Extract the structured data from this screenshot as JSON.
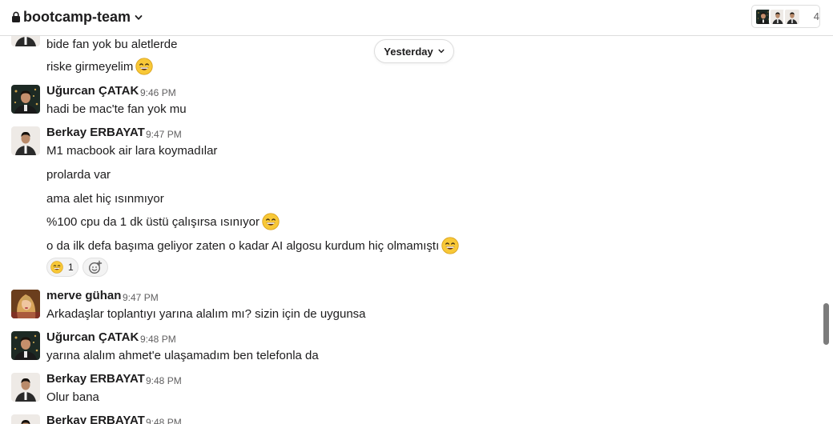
{
  "channel": {
    "name": "bootcamp-team",
    "icon": "lock-icon",
    "chevron": "chevron-down-icon"
  },
  "members": {
    "count": "4"
  },
  "date_divider": {
    "label": "Yesterday"
  },
  "messages": [
    {
      "text": "bide fan yok bu aletlerde"
    },
    {
      "text": "riske girmeyelim",
      "emoji": "grinning-face-with-smiling-eyes"
    },
    {
      "sender": "Uğurcan ÇATAK",
      "time": "9:46 PM",
      "text": "hadi be mac'te fan yok mu"
    },
    {
      "sender": "Berkay ERBAYAT",
      "time": "9:47 PM",
      "text": "M1 macbook air lara koymadılar"
    },
    {
      "text": "prolarda var"
    },
    {
      "text": "ama alet hiç ısınmıyor"
    },
    {
      "text": "%100 cpu da 1 dk üstü çalışırsa ısınıyor",
      "emoji": "grinning-face-with-smiling-eyes"
    },
    {
      "text": "o da ilk defa başıma geliyor zaten o kadar AI algosu kurdum hiç olmamıştı",
      "emoji": "grinning-face-with-smiling-eyes"
    },
    {
      "sender": "merve gühan",
      "time": "9:47 PM",
      "text": "Arkadaşlar toplantıyı yarına alalım mı? sizin için de uygunsa"
    },
    {
      "sender": "Uğurcan ÇATAK",
      "time": "9:48 PM",
      "text": "yarına alalım ahmet'e ulaşamadım ben telefonla da"
    },
    {
      "sender": "Berkay ERBAYAT",
      "time": "9:48 PM",
      "text": "Olur bana"
    },
    {
      "sender": "Berkay ERBAYAT",
      "time": "9:48 PM"
    }
  ],
  "reaction": {
    "emoji": "grinning-face-with-smiling-eyes",
    "count": "1",
    "add_icon": "add-reaction-icon"
  },
  "colors": {
    "text": "#1d1c1d",
    "muted": "#616061",
    "border": "#dddddd",
    "emoji_face": "#f8c837",
    "scrollbar": "#7c7c7c"
  }
}
